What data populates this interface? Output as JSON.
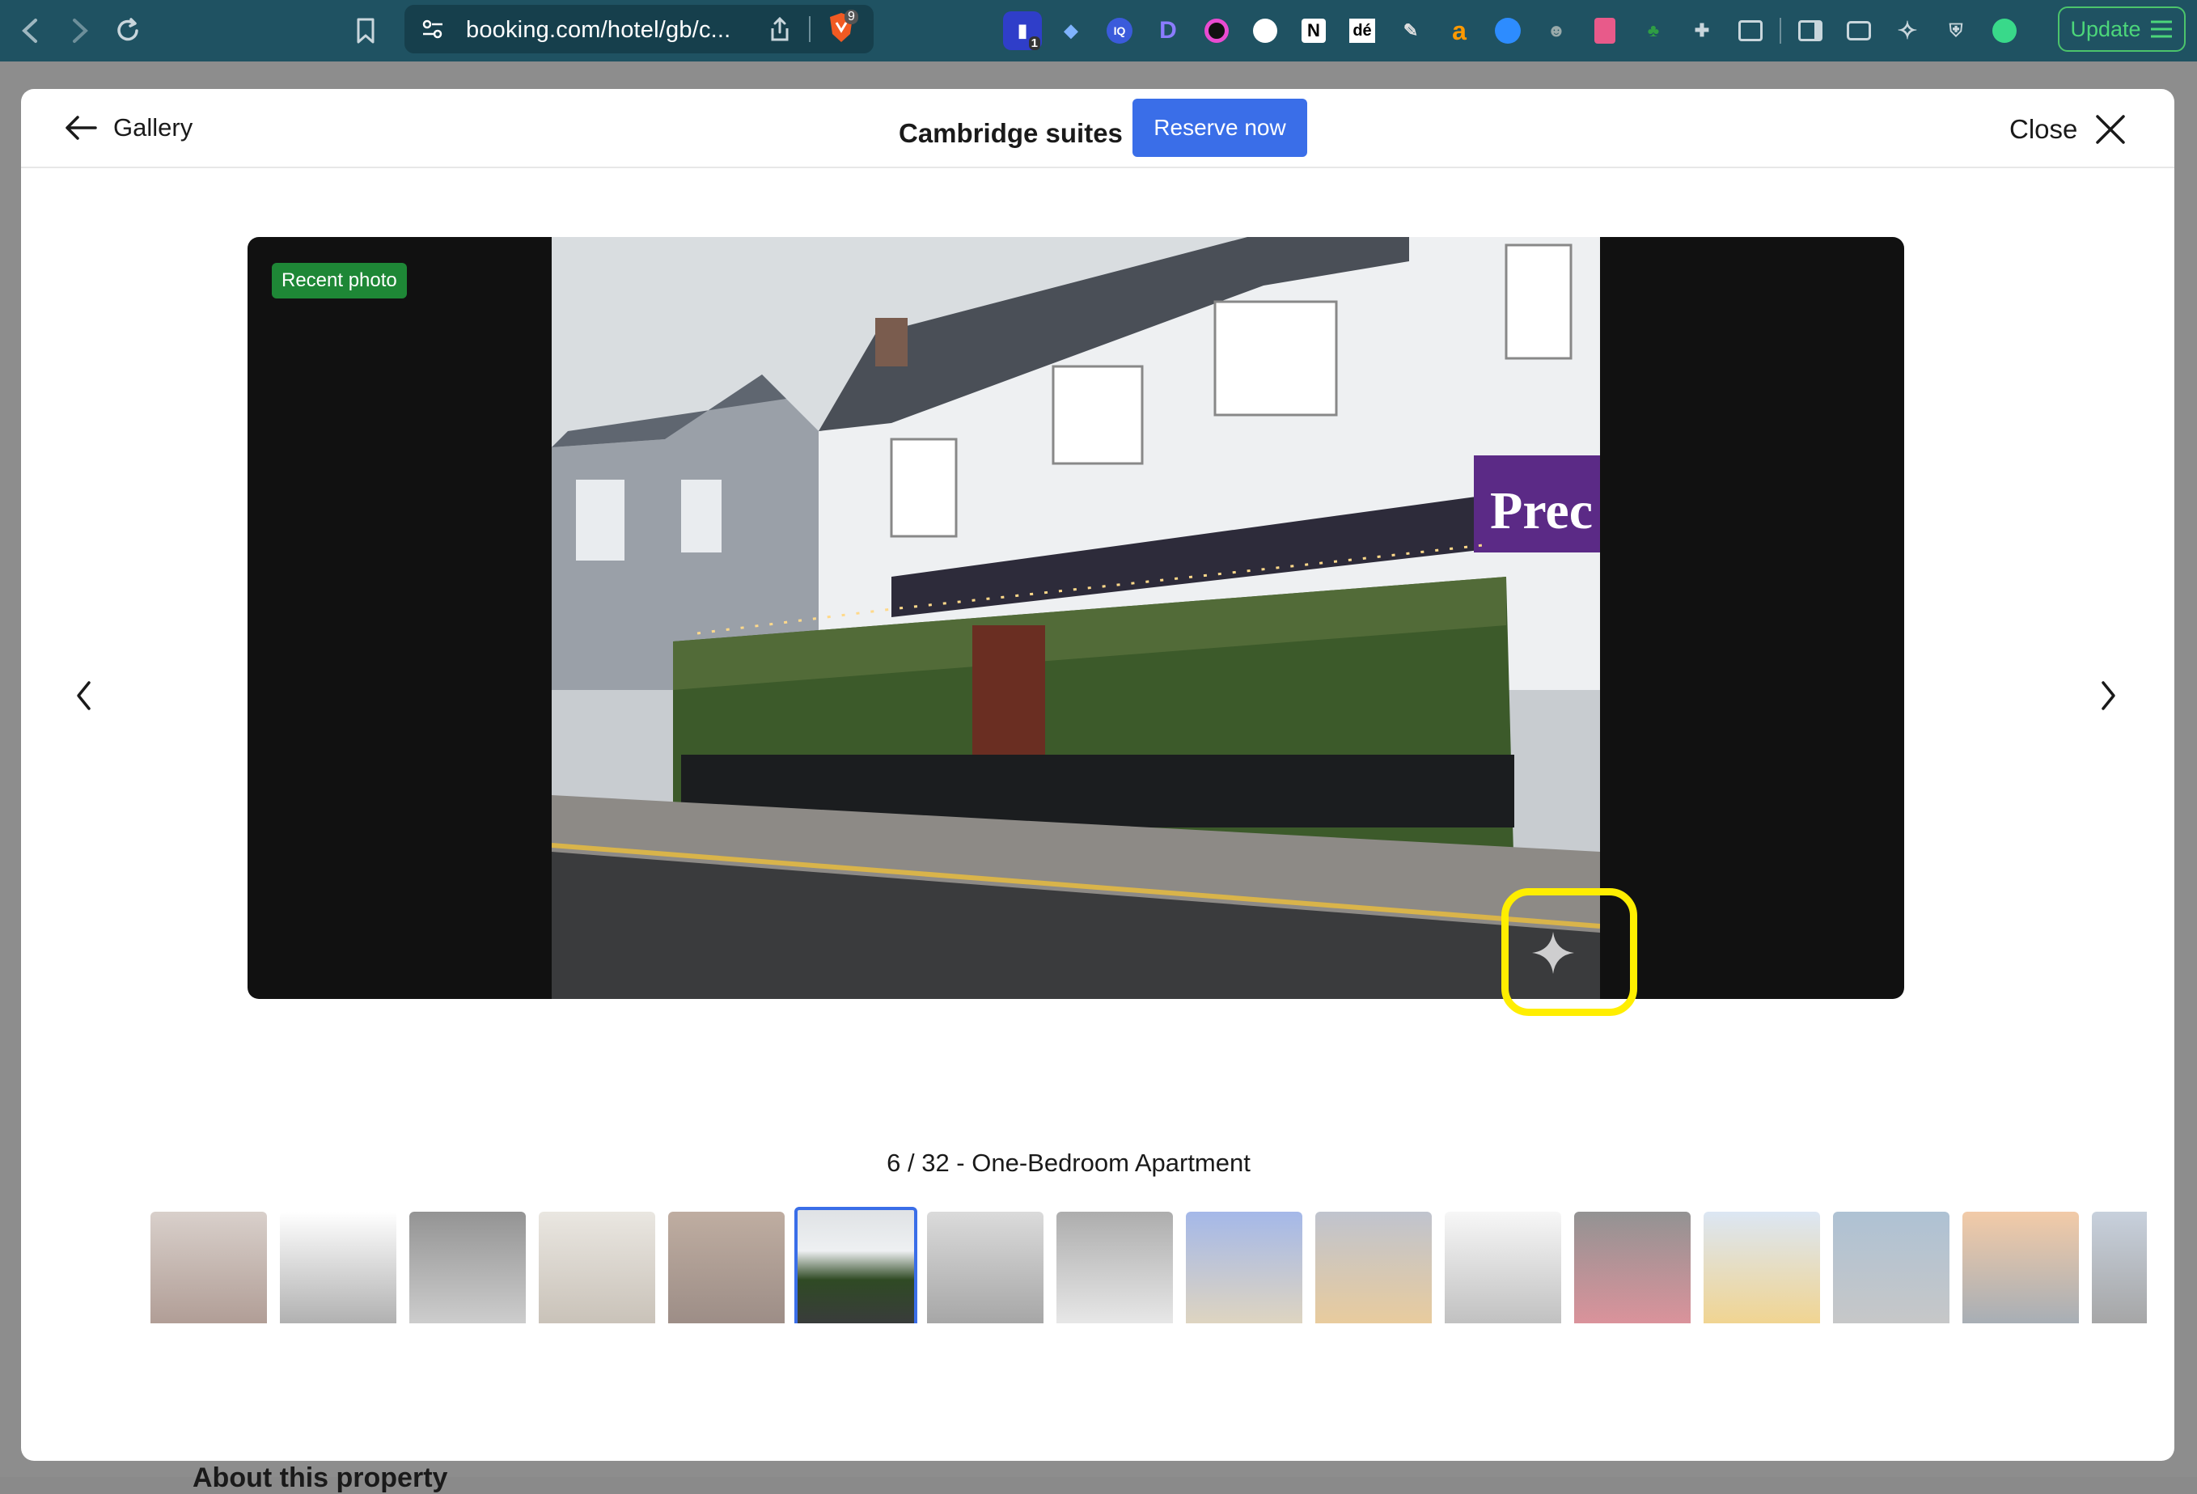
{
  "browser": {
    "url": "booking.com/hotel/gb/c...",
    "shield_count": "9",
    "ext_badge": "1",
    "update_label": "Update",
    "colors": {
      "chrome_bg": "#1f5262",
      "update_green": "#4cd67a"
    }
  },
  "modal": {
    "back_label": "Gallery",
    "title": "Cambridge suites",
    "reserve_label": "Reserve now",
    "close_label": "Close",
    "badge": "Recent photo",
    "caption": "6 / 32 - One-Bedroom Apartment",
    "photo": {
      "index": 6,
      "total": 32
    },
    "colors": {
      "accent": "#3a6ee8",
      "badge_green": "#1e8736",
      "highlight": "#ffee00"
    }
  },
  "thumbnails": [
    {
      "id": 1
    },
    {
      "id": 2
    },
    {
      "id": 3
    },
    {
      "id": 4
    },
    {
      "id": 5
    },
    {
      "id": 6,
      "active": true
    },
    {
      "id": 7
    },
    {
      "id": 8
    },
    {
      "id": 9
    },
    {
      "id": 10
    },
    {
      "id": 11
    },
    {
      "id": 12
    },
    {
      "id": 13
    },
    {
      "id": 14
    },
    {
      "id": 15
    },
    {
      "id": 16
    }
  ],
  "behind_page": {
    "heading_fragment": "About this property"
  }
}
